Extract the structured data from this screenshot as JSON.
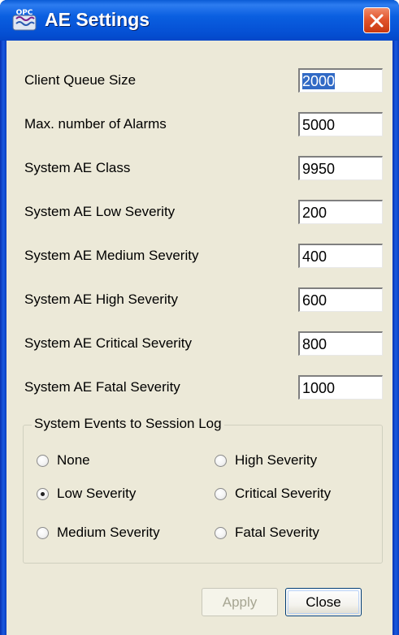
{
  "window": {
    "title": "AE Settings",
    "icon": "opc-app-icon",
    "icon_text": "OPC",
    "close_icon": "close-x-icon",
    "colors": {
      "title_bar": "#0550d4",
      "close_button": "#e2562e",
      "client_bg": "#ece9d8",
      "selection": "#316ac5"
    }
  },
  "settings": [
    {
      "label": "Client Queue Size",
      "value": "2000",
      "selected": true
    },
    {
      "label": "Max. number of Alarms",
      "value": "5000"
    },
    {
      "label": "System AE Class",
      "value": "9950"
    },
    {
      "label": "System AE Low Severity",
      "value": "200"
    },
    {
      "label": "System AE Medium Severity",
      "value": "400"
    },
    {
      "label": "System AE High Severity",
      "value": "600"
    },
    {
      "label": "System AE Critical Severity",
      "value": "800"
    },
    {
      "label": "System AE Fatal Severity",
      "value": "1000"
    }
  ],
  "session_log": {
    "legend": "System Events to Session Log",
    "options": [
      {
        "label": "None",
        "checked": false
      },
      {
        "label": "High Severity",
        "checked": false
      },
      {
        "label": "Low Severity",
        "checked": true
      },
      {
        "label": "Critical Severity",
        "checked": false
      },
      {
        "label": "Medium Severity",
        "checked": false
      },
      {
        "label": "Fatal Severity",
        "checked": false
      }
    ]
  },
  "buttons": {
    "apply": {
      "label": "Apply",
      "enabled": false
    },
    "close": {
      "label": "Close",
      "enabled": true
    }
  }
}
